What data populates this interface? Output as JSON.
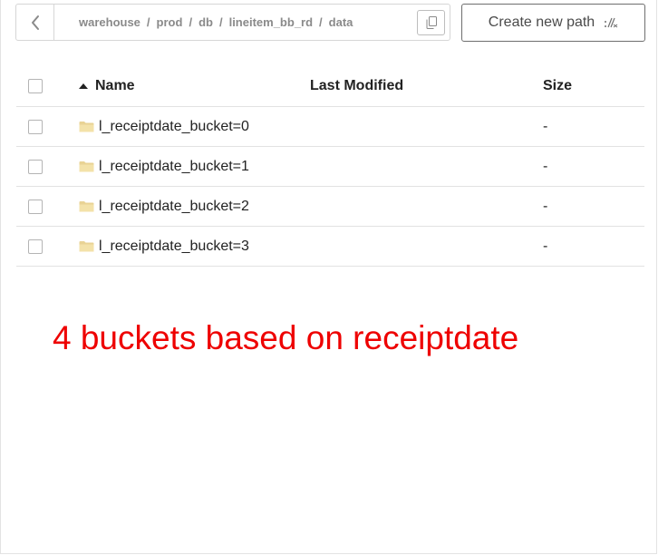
{
  "breadcrumb": {
    "items": [
      {
        "label": "warehouse"
      },
      {
        "label": "prod"
      },
      {
        "label": "db"
      },
      {
        "label": "lineitem_bb_rd"
      },
      {
        "label": "data"
      }
    ],
    "separator": "/"
  },
  "toolbar": {
    "create_label": "Create new path"
  },
  "table": {
    "headers": {
      "name": "Name",
      "modified": "Last Modified",
      "size": "Size"
    },
    "sort": {
      "column": "name",
      "direction": "ascending"
    },
    "rows": [
      {
        "name": "l_receiptdate_bucket=0",
        "modified": "",
        "size": "-"
      },
      {
        "name": "l_receiptdate_bucket=1",
        "modified": "",
        "size": "-"
      },
      {
        "name": "l_receiptdate_bucket=2",
        "modified": "",
        "size": "-"
      },
      {
        "name": "l_receiptdate_bucket=3",
        "modified": "",
        "size": "-"
      }
    ]
  },
  "annotation": {
    "text": "4 buckets based on receiptdate",
    "color": "#ee0000"
  },
  "icons": {
    "back": "chevron-left-icon",
    "copy": "copy-icon",
    "create": "path-icon",
    "folder": "folder-icon"
  }
}
